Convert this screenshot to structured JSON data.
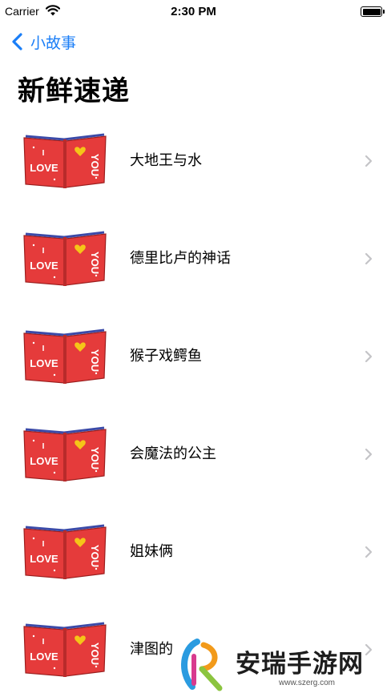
{
  "status_bar": {
    "carrier": "Carrier",
    "time": "2:30 PM"
  },
  "nav": {
    "back_label": "小故事"
  },
  "title": "新鲜速递",
  "book_cover": {
    "left_page_line1": "I",
    "left_page_line2": "LOVE",
    "right_page_text": "YOU",
    "color": "#e53b3b"
  },
  "stories": [
    {
      "title": "大地王与水"
    },
    {
      "title": "德里比卢的神话"
    },
    {
      "title": "猴子戏鳄鱼"
    },
    {
      "title": "会魔法的公主"
    },
    {
      "title": "姐妹俩"
    },
    {
      "title": "津图的"
    }
  ],
  "watermark": {
    "text": "安瑞手游网",
    "url": "www.szerg.com"
  },
  "colors": {
    "accent": "#1a7ef7",
    "chevron": "#c4c4c7",
    "book_red": "#e53b3b",
    "book_spine": "#3b4aa8"
  }
}
